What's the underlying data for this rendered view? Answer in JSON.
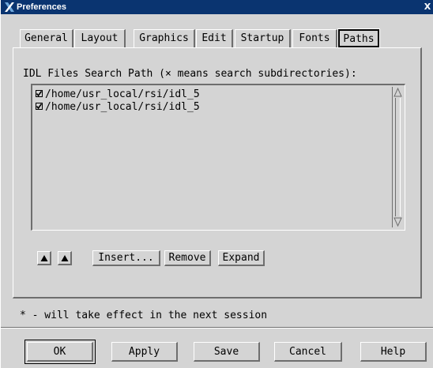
{
  "window": {
    "title": "Preferences",
    "close_glyph": "X"
  },
  "tabs": [
    {
      "label": "General",
      "active": false
    },
    {
      "label": "Layout",
      "active": false
    },
    {
      "label": "Graphics",
      "active": false
    },
    {
      "label": "Edit",
      "active": false
    },
    {
      "label": "Startup",
      "active": false
    },
    {
      "label": "Fonts",
      "active": false
    },
    {
      "label": "Paths",
      "active": true
    }
  ],
  "paths_panel": {
    "label": "IDL Files Search Path (× means search subdirectories):",
    "entries": [
      {
        "path": "/home/usr_local/rsi/idl_5",
        "checked": true
      },
      {
        "path": "/home/usr_local/rsi/idl_5",
        "checked": true
      }
    ],
    "buttons": {
      "insert": "Insert...",
      "remove": "Remove",
      "expand": "Expand"
    },
    "icons": {
      "move_up_left": "triangle-up-icon",
      "move_up_right": "triangle-up-icon",
      "scroll_up": "scroll-up-arrow-icon",
      "scroll_down": "scroll-down-arrow-icon",
      "checkbox": "checked-box-icon"
    }
  },
  "note": "* - will take effect in the next session",
  "footer": {
    "ok": "OK",
    "apply": "Apply",
    "save": "Save",
    "cancel": "Cancel",
    "help": "Help"
  },
  "colors": {
    "titlebar": "#0a3470",
    "background": "#d4d4d4",
    "shadow": "#6e6e6e",
    "highlight": "#ffffff"
  }
}
